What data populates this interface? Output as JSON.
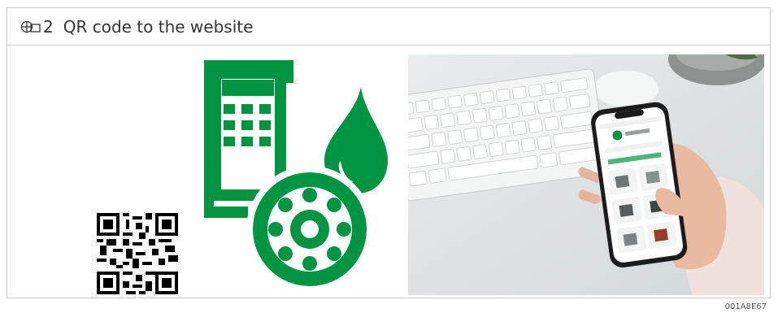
{
  "figure": {
    "icon": "figure-reference-icon",
    "number": "2",
    "title": "QR code to the website",
    "id": "001A8E67"
  },
  "colors": {
    "brand_green": "#009540",
    "frame": "#c9c9c9",
    "text": "#333333"
  }
}
